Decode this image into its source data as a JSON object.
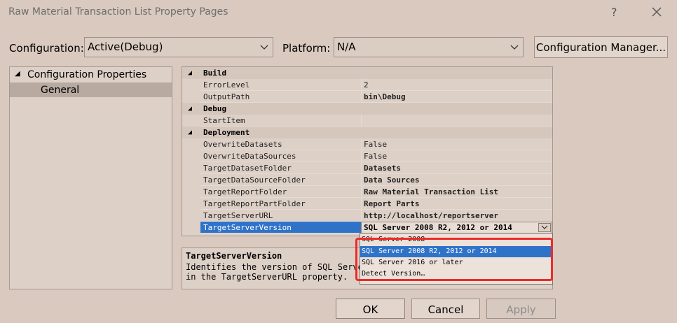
{
  "window": {
    "title": "Raw Material Transaction List Property Pages",
    "help_glyph": "?"
  },
  "toolbar": {
    "configuration_label": "Configuration:",
    "configuration_value": "Active(Debug)",
    "platform_label": "Platform:",
    "platform_value": "N/A",
    "config_manager_label": "Configuration Manager..."
  },
  "tree": {
    "root_caret": "◢",
    "root_label": "Configuration Properties",
    "items": [
      {
        "label": "General",
        "selected": true
      }
    ]
  },
  "grid": {
    "categories": {
      "build": "Build",
      "debug": "Debug",
      "deployment": "Deployment"
    },
    "build_rows": [
      {
        "name": "ErrorLevel",
        "value": "2"
      },
      {
        "name": "OutputPath",
        "value": "bin\\Debug"
      }
    ],
    "debug_rows": [
      {
        "name": "StartItem",
        "value": ""
      }
    ],
    "deployment_rows": [
      {
        "name": "OverwriteDatasets",
        "value": "False"
      },
      {
        "name": "OverwriteDataSources",
        "value": "False"
      },
      {
        "name": "TargetDatasetFolder",
        "value": "Datasets"
      },
      {
        "name": "TargetDataSourceFolder",
        "value": "Data Sources"
      },
      {
        "name": "TargetReportFolder",
        "value": "Raw Material Transaction List"
      },
      {
        "name": "TargetReportPartFolder",
        "value": "Report Parts"
      },
      {
        "name": "TargetServerURL",
        "value": "http://localhost/reportserver"
      },
      {
        "name": "TargetServerVersion",
        "value": "SQL Server 2008 R2, 2012 or 2014"
      }
    ],
    "caret": "◢"
  },
  "dropdown": {
    "options": [
      {
        "label": "SQL Server 2008",
        "selected": false
      },
      {
        "label": "SQL Server 2008 R2, 2012 or 2014",
        "selected": true
      },
      {
        "label": "SQL Server 2016 or later",
        "selected": false
      },
      {
        "label": "Detect Version…",
        "selected": false
      }
    ],
    "highlight_color": "#ee2a2a"
  },
  "description": {
    "title": "TargetServerVersion",
    "text_line1": "Identifies the version of SQL Server",
    "text_line2": "in the TargetServerURL property."
  },
  "buttons": {
    "ok": "OK",
    "cancel": "Cancel",
    "apply": "Apply"
  },
  "colors": {
    "background": "#d9c9bf",
    "selection": "#2f73c9"
  }
}
